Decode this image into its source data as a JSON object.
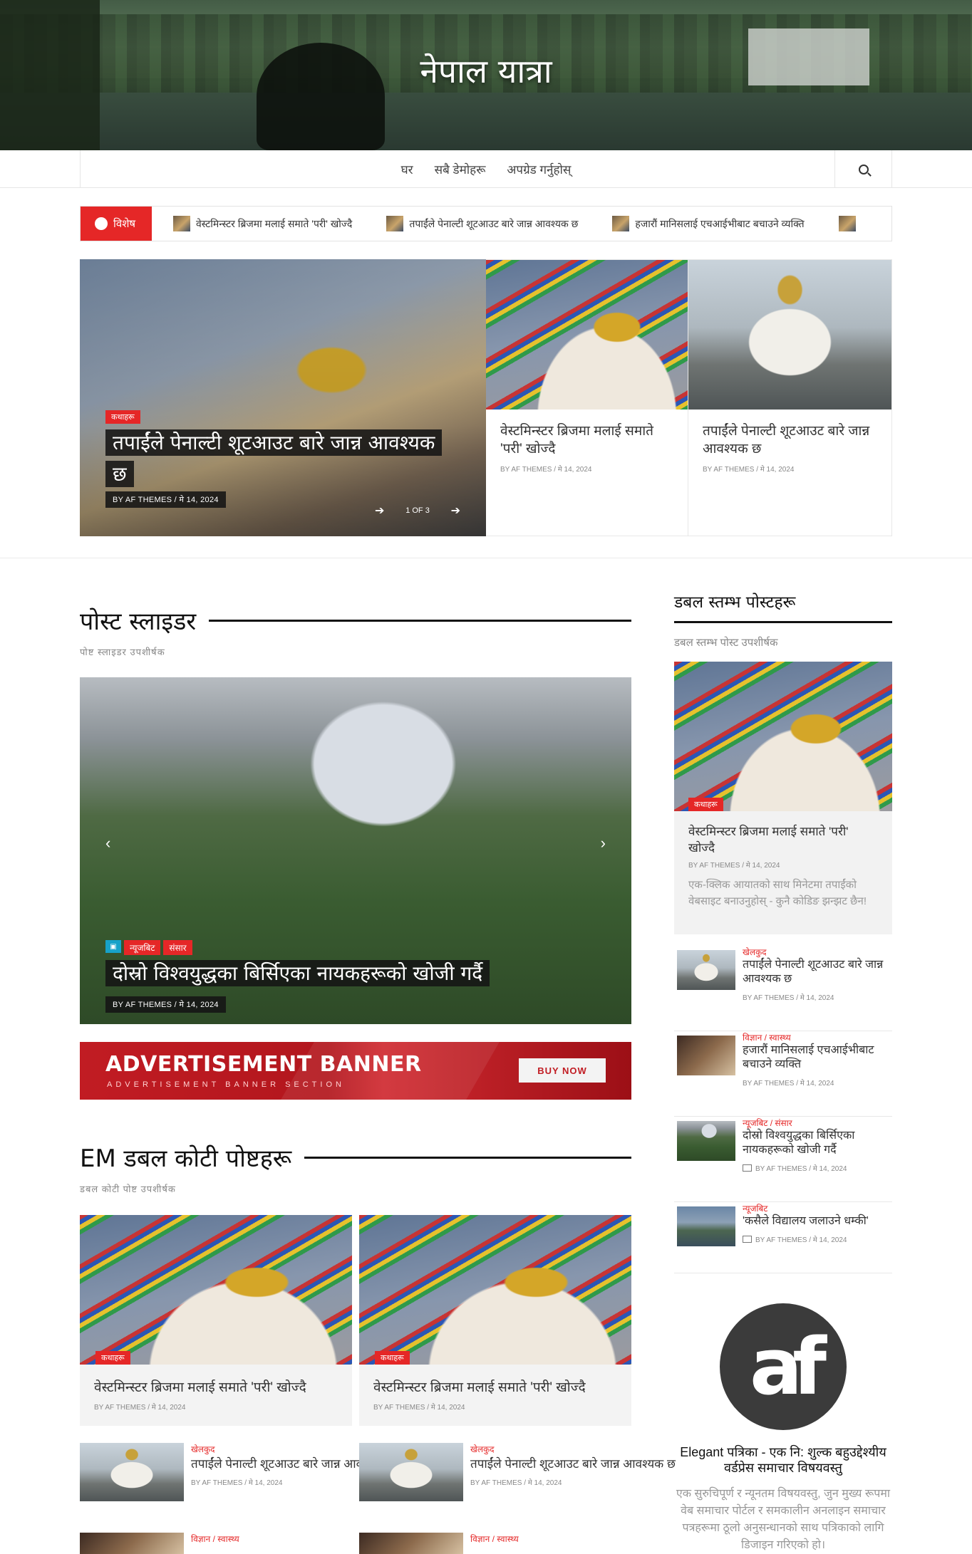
{
  "site": {
    "title": "नेपाल यात्रा"
  },
  "nav": {
    "items": [
      "घर",
      "सबै डेमोहरू",
      "अपग्रेड गर्नुहोस्"
    ]
  },
  "ticker": {
    "badge": "विशेष",
    "items": [
      "वेस्टमिन्स्टर ब्रिजमा मलाई समाते 'परी' खोज्दै",
      "तपाईंले पेनाल्टी शूटआउट बारे जान्न आवश्यक छ",
      "हजारौं मानिसलाई एचआईभीबाट बचाउने व्यक्ति"
    ]
  },
  "featured": {
    "main": {
      "category": "कथाहरू",
      "title": "तपाईंले पेनाल्टी शूटआउट बारे जान्न आवश्यक छ",
      "meta": "BY AF THEMES  /  मे 14, 2024",
      "pager": "1 OF 3"
    },
    "cards": [
      {
        "title": "वेस्टमिन्स्टर ब्रिजमा मलाई समाते 'परी' खोज्दै",
        "meta": "BY AF THEMES / मे 14, 2024"
      },
      {
        "title": "तपाईंले पेनाल्टी शूटआउट बारे जान्न आवश्यक छ",
        "meta": "BY AF THEMES / मे 14, 2024"
      }
    ]
  },
  "post_slider": {
    "heading": "पोस्ट स्लाइडर",
    "subheading": "पोष्ट स्लाइडर उपशीर्षक",
    "categories": [
      "न्यूजबिट",
      "संसार"
    ],
    "title": "दोस्रो विश्वयुद्धका बिर्सिएका नायकहरूको खोजी गर्दै",
    "meta": "BY AF THEMES  /  मे 14, 2024"
  },
  "ad": {
    "title": "ADVERTISEMENT BANNER",
    "subtitle": "ADVERTISEMENT BANNER SECTION",
    "button": "BUY NOW"
  },
  "double_column": {
    "heading": "EM डबल कोटी पोष्टहरू",
    "subheading": "डबल कोटी पोष्ट उपशीर्षक",
    "cards": [
      {
        "category": "कथाहरू",
        "title": "वेस्टमिन्स्टर ब्रिजमा मलाई समाते 'परी' खोज्दै",
        "meta": "BY AF THEMES / मे 14, 2024"
      },
      {
        "category": "कथाहरू",
        "title": "वेस्टमिन्स्टर ब्रिजमा मलाई समाते 'परी' खोज्दै",
        "meta": "BY AF THEMES / मे 14, 2024"
      }
    ],
    "list": [
      {
        "category": "खेलकुद",
        "title": "तपाईंले पेनाल्टी शूटआउट बारे जान्न आवश्यक छ",
        "meta": "BY AF THEMES / मे 14, 2024"
      },
      {
        "category": "खेलकुद",
        "title": "तपाईंले पेनाल्टी शूटआउट बारे जान्न आवश्यक छ",
        "meta": "BY AF THEMES / मे 14, 2024"
      },
      {
        "category": "विज्ञान  /  स्वास्थ्य"
      },
      {
        "category": "विज्ञान  /  स्वास्थ्य"
      }
    ]
  },
  "sidebar": {
    "heading": "डबल स्तम्भ पोस्टहरू",
    "subheading": "डबल स्तम्भ पोस्ट उपशीर्षक",
    "featured": {
      "category": "कथाहरू",
      "title": "वेस्टमिन्स्टर ब्रिजमा मलाई समाते 'परी' खोज्दै",
      "meta": "BY AF THEMES / मे 14, 2024",
      "excerpt": "एक-क्लिक आयातको साथ मिनेटमा तपाईंको वेबसाइट बनाउनुहोस् - कुनै कोडिङ झन्झट छैन!"
    },
    "list": [
      {
        "category": "खेलकुद",
        "title": "तपाईंले पेनाल्टी शूटआउट बारे जान्न आवश्यक छ",
        "meta": "BY AF THEMES / मे 14, 2024"
      },
      {
        "category": "विज्ञान  /  स्वास्थ्य",
        "title": "हजारौं मानिसलाई एचआईभीबाट बचाउने व्यक्ति",
        "meta": "BY AF THEMES / मे 14, 2024"
      },
      {
        "category": "न्यूजबिट  /  संसार",
        "title": "दोस्रो विश्वयुद्धका बिर्सिएका नायकहरूको खोजी गर्दै",
        "meta": "BY AF THEMES / मे 14, 2024"
      },
      {
        "category": "न्यूजबिट",
        "title": "'कसैले विद्यालय जलाउने धम्की'",
        "meta": "BY AF THEMES / मे 14, 2024"
      }
    ],
    "about": {
      "logo": "af",
      "title": "Elegant पत्रिका - एक नि: शुल्क बहुउद्देश्यीय वर्डप्रेस समाचार विषयवस्तु",
      "description": "एक सुरुचिपूर्ण र न्यूनतम विषयवस्तु, जुन मुख्य रूपमा वेब समाचार पोर्टल र समकालीन अनलाइन समाचार पत्रहरूमा ठूलो अनुसन्धानको साथ पत्रिकाको लागि डिजाइन गरिएको हो।"
    }
  }
}
